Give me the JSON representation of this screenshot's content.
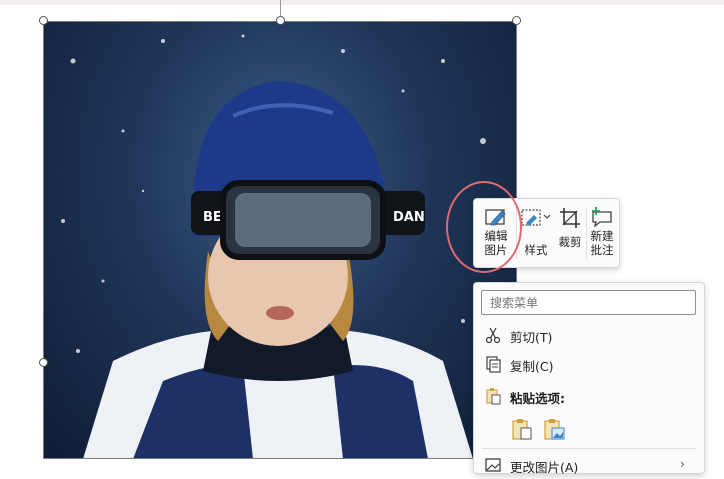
{
  "quick_toolbar": {
    "edit_picture": {
      "line1": "编辑",
      "line2": "图片"
    },
    "style": {
      "label": "样式"
    },
    "crop": {
      "label": "裁剪"
    },
    "new_comment": {
      "line1": "新建",
      "line2": "批注"
    }
  },
  "context_menu": {
    "search_placeholder": "搜索菜单",
    "cut": "剪切(T)",
    "copy": "复制(C)",
    "paste_options": "粘贴选项:",
    "change_picture": "更改图片(A)"
  },
  "photo": {
    "helmet_text_left": "BEY",
    "helmet_text_right": "DAN"
  },
  "colors": {
    "highlight": "#e06a6e",
    "icon_accent": "#3a86c8",
    "paste_icon": "#c9a23b",
    "comment_plus": "#2e9e4f"
  }
}
